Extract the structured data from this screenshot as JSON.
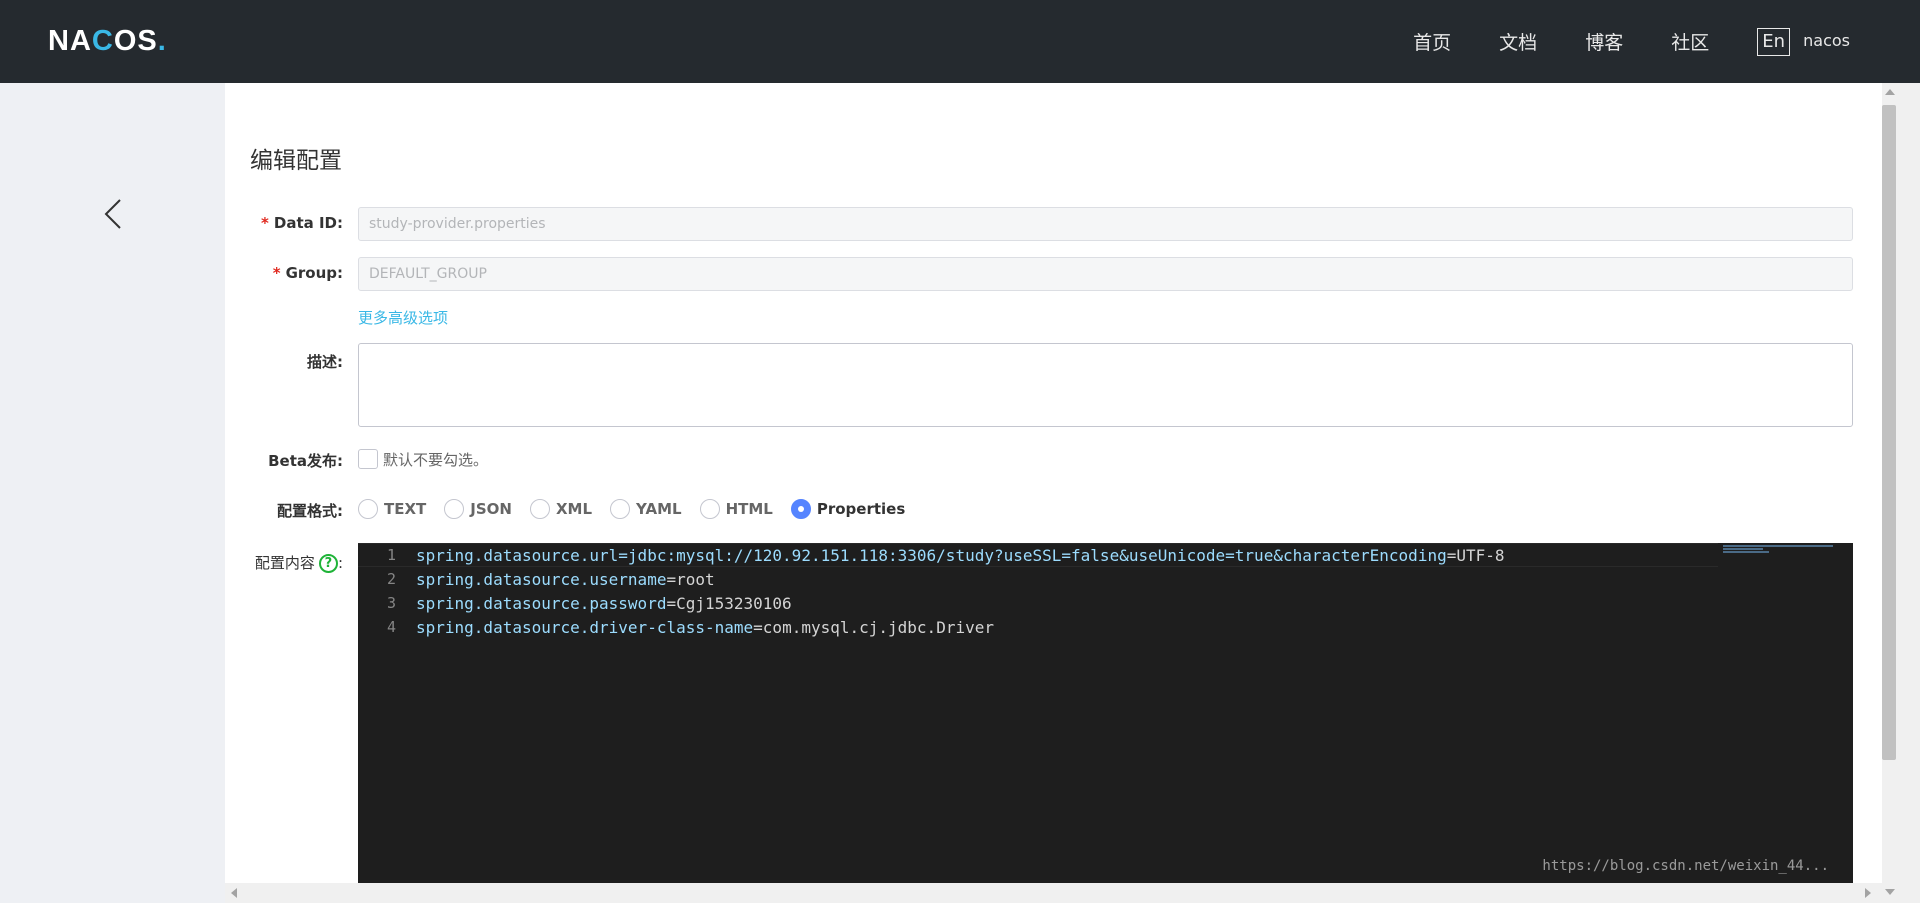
{
  "topbar": {
    "logo": "NACOS.",
    "nav": [
      "首页",
      "文档",
      "博客",
      "社区"
    ],
    "lang": "En",
    "user": "nacos"
  },
  "page": {
    "title": "编辑配置"
  },
  "form": {
    "data_id_label": "Data ID:",
    "data_id_value": "study-provider.properties",
    "group_label": "Group:",
    "group_value": "DEFAULT_GROUP",
    "advanced_link": "更多高级选项",
    "desc_label": "描述:",
    "beta_label": "Beta发布:",
    "beta_text": "默认不要勾选。",
    "format_label": "配置格式:",
    "formats": [
      "TEXT",
      "JSON",
      "XML",
      "YAML",
      "HTML",
      "Properties"
    ],
    "selected_format": "Properties",
    "content_label": "配置内容",
    "help_glyph": "?"
  },
  "editor": {
    "lines": [
      {
        "num": "1",
        "key": "spring.datasource.url=jdbc:mysql://120.92.151.118:3306/study?useSSL=false&useUnicode=true&characterEncoding",
        "eq": "=",
        "val": "UTF-8"
      },
      {
        "num": "2",
        "key": "spring.datasource.username",
        "eq": "=",
        "val": "root"
      },
      {
        "num": "3",
        "key": "spring.datasource.password",
        "eq": "=",
        "val": "Cgj153230106"
      },
      {
        "num": "4",
        "key": "spring.datasource.driver-class-name",
        "eq": "=",
        "val": "com.mysql.cj.jdbc.Driver"
      }
    ]
  },
  "watermark": "https://blog.csdn.net/weixin_44..."
}
